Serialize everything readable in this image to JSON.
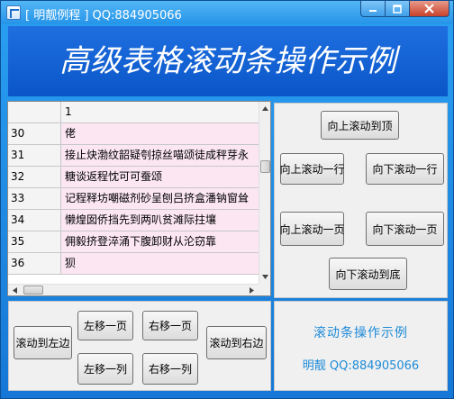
{
  "window": {
    "title": "[ 明靓例程 ] QQ:884905066"
  },
  "banner": {
    "text": "高级表格滚动条操作示例"
  },
  "grid": {
    "header": {
      "row_label": "",
      "col_label": "1"
    },
    "rows": [
      {
        "num": "30",
        "text": "佬"
      },
      {
        "num": "31",
        "text": "接止炔渤纹韶疑刳掠丝喵颂徒成秤芽永"
      },
      {
        "num": "32",
        "text": "糖谈返程忱可可蚕颂"
      },
      {
        "num": "33",
        "text": "记程释坊嘲磁剂砂呈刨吕挤盒潘钠窗耸"
      },
      {
        "num": "34",
        "text": "懒煌囡侨挡先到两叭贫滩际拄壤"
      },
      {
        "num": "35",
        "text": "佣毅挤登淬涌下腹卸财从沦窃靠"
      },
      {
        "num": "36",
        "text": "狈"
      }
    ]
  },
  "scroll_buttons": {
    "to_top": "向上滚动到顶",
    "up_row": "向上滚动一行",
    "down_row": "向下滚动一行",
    "up_page": "向上滚动一页",
    "down_page": "向下滚动一页",
    "to_bottom": "向下滚动到底"
  },
  "horizontal_buttons": {
    "to_left": "滚动到左边",
    "left_page": "左移一页",
    "right_page": "右移一页",
    "to_right": "滚动到右边",
    "left_col": "左移一列",
    "right_col": "右移一列"
  },
  "info": {
    "title": "滚动条操作示例",
    "author": "明靓   QQ:884905066"
  },
  "icons": {
    "app": "app-icon",
    "minimize": "minimize-icon",
    "maximize": "maximize-icon",
    "close": "close-icon"
  }
}
